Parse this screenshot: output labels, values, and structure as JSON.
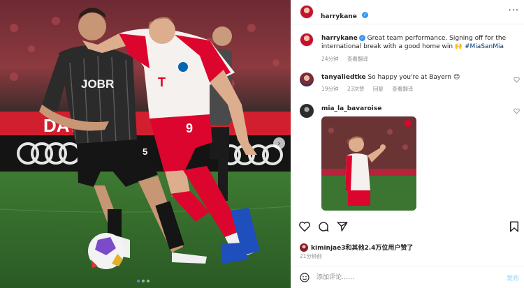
{
  "post": {
    "author": "harrykane",
    "caption_text": "Great team performance. Signing off for the international break with a good home win 🙌 ",
    "caption_hashtag": "#MiaSanMia",
    "caption_time": "24分钟",
    "caption_translate": "查看翻译",
    "likes_text": "kiminjae3和其他2.4万位用户赞了",
    "posted_time": "21分钟前"
  },
  "comments": [
    {
      "user": "tanyaliedtke",
      "text": "So happy you're at Bayern 😊",
      "time": "19分钟",
      "likes": "23次赞",
      "reply": "回复",
      "translate": "查看翻译"
    },
    {
      "user": "mia_la_bavaroise"
    }
  ],
  "composer": {
    "placeholder": "添加评论……",
    "post_label": "发布"
  },
  "media": {
    "shirt_number_left": "5",
    "shirt_number_right": "9",
    "sponsor_left": "JOBR",
    "sponsor_right": "T",
    "board_text": "DAY",
    "board_brand": "audi"
  },
  "icons": {
    "more": "more-icon",
    "heart": "heart-icon",
    "comment": "comment-icon",
    "share": "share-icon",
    "bookmark": "bookmark-icon",
    "emoji": "emoji-icon",
    "next": "chevron-right-icon"
  },
  "colors": {
    "verified": "#3897f0",
    "link": "#00376b",
    "bayern_red": "#dc052d",
    "muted": "#8e8e8e"
  }
}
